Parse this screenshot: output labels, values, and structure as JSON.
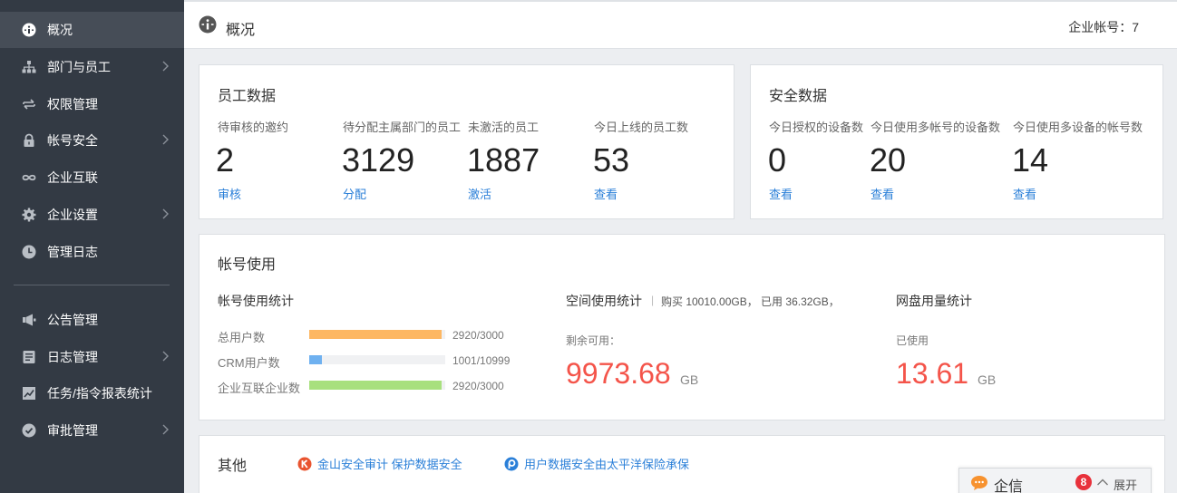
{
  "sidebar": {
    "items": [
      {
        "label": "概况",
        "icon": "info-icon"
      },
      {
        "label": "部门与员工",
        "icon": "org-chart-icon"
      },
      {
        "label": "权限管理",
        "icon": "swap-icon"
      },
      {
        "label": "帐号安全",
        "icon": "lock-icon"
      },
      {
        "label": "企业互联",
        "icon": "link-icon"
      },
      {
        "label": "企业设置",
        "icon": "gear-icon"
      },
      {
        "label": "管理日志",
        "icon": "clock-icon"
      },
      {
        "label": "公告管理",
        "icon": "megaphone-icon"
      },
      {
        "label": "日志管理",
        "icon": "document-icon"
      },
      {
        "label": "任务/指令报表统计",
        "icon": "trend-chart-icon"
      },
      {
        "label": "审批管理",
        "icon": "check-badge-icon"
      }
    ]
  },
  "header": {
    "title": "概况",
    "account_text": "企业帐号：7"
  },
  "employee_data": {
    "title": "员工数据",
    "stats": [
      {
        "label": "待审核的邀约",
        "value": "2",
        "link": "审核"
      },
      {
        "label": "待分配主属部门的员工",
        "value": "3129",
        "link": "分配"
      },
      {
        "label": "未激活的员工",
        "value": "1887",
        "link": "激活"
      },
      {
        "label": "今日上线的员工数",
        "value": "53",
        "link": "查看"
      }
    ]
  },
  "security_data": {
    "title": "安全数据",
    "stats": [
      {
        "label": "今日授权的设备数",
        "value": "0",
        "link": "查看"
      },
      {
        "label": "今日使用多帐号的设备数",
        "value": "20",
        "link": "查看"
      },
      {
        "label": "今日使用多设备的帐号数",
        "value": "14",
        "link": "查看"
      }
    ]
  },
  "account_usage": {
    "title": "帐号使用",
    "stats_title": "帐号使用统计",
    "bars": [
      {
        "label": "总用户数",
        "used": 2920,
        "total": 3000,
        "text": "2920/3000",
        "color": "#fdb762"
      },
      {
        "label": "CRM用户数",
        "used": 1001,
        "total": 10999,
        "text": "1001/10999",
        "color": "#6fb1f0"
      },
      {
        "label": "企业互联企业数",
        "used": 2920,
        "total": 3000,
        "text": "2920/3000",
        "color": "#a8e07e"
      }
    ],
    "space": {
      "title": "空间使用统计",
      "separator": "|",
      "detail": "购买 10010.00GB， 已用 36.32GB，",
      "remaining_label": "剩余可用：",
      "remaining_value": "9973.68",
      "unit": "GB"
    },
    "disk": {
      "title": "网盘用量统计",
      "used_label": "已使用",
      "used_value": "13.61",
      "unit": "GB"
    }
  },
  "other": {
    "title": "其他",
    "links": [
      {
        "text": "金山安全审计 保护数据安全",
        "icon": "kingsoft-icon"
      },
      {
        "text": "用户数据安全由太平洋保险承保",
        "icon": "insurance-icon"
      }
    ]
  },
  "chat": {
    "label": "企信",
    "badge": "8",
    "expand_label": "展开"
  }
}
